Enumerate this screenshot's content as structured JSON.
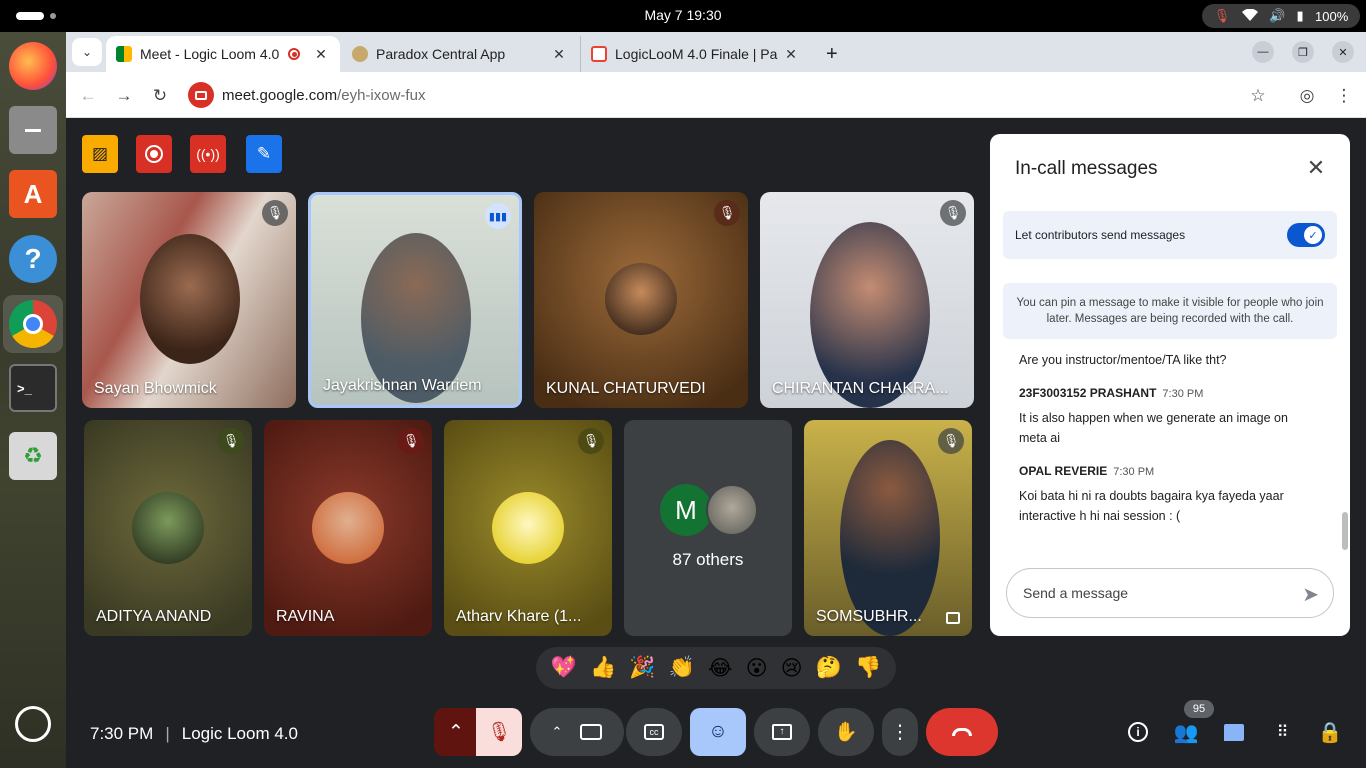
{
  "system": {
    "clock": "May 7  19:30",
    "battery": "100%"
  },
  "browser": {
    "tabs": [
      {
        "title": "Meet - Logic Loom 4.0",
        "active": true
      },
      {
        "title": "Paradox Central App",
        "active": false
      },
      {
        "title": "LogicLooM 4.0 Finale | Pa",
        "active": false
      }
    ],
    "new_tab": "+",
    "url_host": "meet.google.com",
    "url_path": "/eyh-ixow-fux"
  },
  "participants": [
    {
      "name": "Sayan Bhowmick"
    },
    {
      "name": "Jayakrishnan Warriem"
    },
    {
      "name": "KUNAL CHATURVEDI"
    },
    {
      "name": "CHIRANTAN CHAKRA..."
    },
    {
      "name": "ADITYA ANAND"
    },
    {
      "name": "RAVINA"
    },
    {
      "name": "Atharv Khare (1..."
    },
    {
      "name": "SOMSUBHR..."
    }
  ],
  "others": {
    "initial": "M",
    "label": "87 others"
  },
  "chat": {
    "title": "In-call messages",
    "toggle_label": "Let contributors send messages",
    "info": "You can pin a message to make it visible for people who join later. Messages are being recorded with the call.",
    "messages": [
      {
        "sender": "",
        "time": "",
        "text": "Are you instructor/mentoe/TA like tht?"
      },
      {
        "sender": "23F3003152 PRASHANT",
        "time": "7:30 PM",
        "text": "It is also happen when we generate an image on meta ai"
      },
      {
        "sender": "OPAL REVERIE",
        "time": "7:30 PM",
        "text": "Koi bata hi ni ra doubts bagaira kya fayeda yaar interactive h hi nai session : ("
      }
    ],
    "placeholder": "Send a message"
  },
  "reactions": [
    "💖",
    "👍",
    "🎉",
    "👏",
    "😂",
    "😮",
    "😢",
    "🤔",
    "👎"
  ],
  "meeting": {
    "time": "7:30 PM",
    "name": "Logic Loom 4.0",
    "participant_count": "95"
  },
  "colors": {
    "accent": "#0b57d0",
    "end_call": "#dc362e",
    "mic_off": "#f9dedc",
    "emoji_active": "#a8c7fa"
  }
}
